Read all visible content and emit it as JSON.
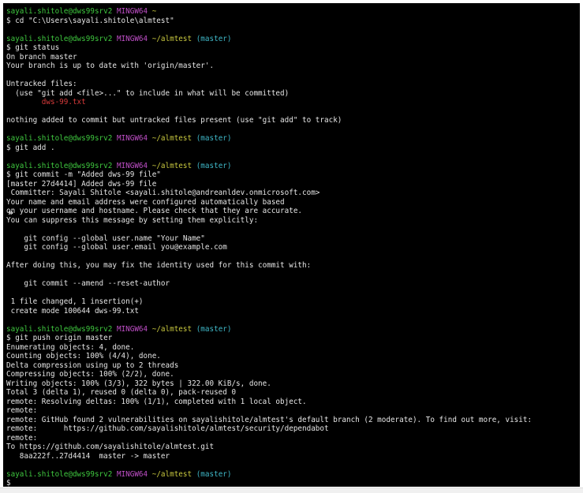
{
  "colors": {
    "terminal_bg": "#000000",
    "text": "#e6e6e6",
    "prompt_user": "#3fc83f",
    "prompt_env": "#c04fc8",
    "prompt_path": "#c8c83f",
    "prompt_branch": "#3fb8c8",
    "untracked_file": "#d63a3a"
  },
  "icons": {
    "collapse": "double-chevron-right-icon"
  },
  "terminal": {
    "lines": [
      [
        {
          "t": "sayali.shitole@dws99srv2 ",
          "c": "user"
        },
        {
          "t": "MINGW64 ",
          "c": "env"
        },
        {
          "t": "~",
          "c": "path"
        }
      ],
      [
        {
          "t": "$ cd \"C:\\Users\\sayali.shitole\\almtest\"",
          "c": "plain"
        }
      ],
      [],
      [
        {
          "t": "sayali.shitole@dws99srv2 ",
          "c": "user"
        },
        {
          "t": "MINGW64 ",
          "c": "env"
        },
        {
          "t": "~/almtest ",
          "c": "path"
        },
        {
          "t": "(master)",
          "c": "branch"
        }
      ],
      [
        {
          "t": "$ git status",
          "c": "plain"
        }
      ],
      [
        {
          "t": "On branch master",
          "c": "plain"
        }
      ],
      [
        {
          "t": "Your branch is up to date with 'origin/master'.",
          "c": "plain"
        }
      ],
      [],
      [
        {
          "t": "Untracked files:",
          "c": "plain"
        }
      ],
      [
        {
          "t": "  (use \"git add <file>...\" to include in what will be committed)",
          "c": "plain"
        }
      ],
      [
        {
          "t": "        dws-99.txt",
          "c": "red"
        }
      ],
      [],
      [
        {
          "t": "nothing added to commit but untracked files present (use \"git add\" to track)",
          "c": "plain"
        }
      ],
      [],
      [
        {
          "t": "sayali.shitole@dws99srv2 ",
          "c": "user"
        },
        {
          "t": "MINGW64 ",
          "c": "env"
        },
        {
          "t": "~/almtest ",
          "c": "path"
        },
        {
          "t": "(master)",
          "c": "branch"
        }
      ],
      [
        {
          "t": "$ git add .",
          "c": "plain"
        }
      ],
      [],
      [
        {
          "t": "sayali.shitole@dws99srv2 ",
          "c": "user"
        },
        {
          "t": "MINGW64 ",
          "c": "env"
        },
        {
          "t": "~/almtest ",
          "c": "path"
        },
        {
          "t": "(master)",
          "c": "branch"
        }
      ],
      [
        {
          "t": "$ git commit -m \"Added dws-99 file\"",
          "c": "plain"
        }
      ],
      [
        {
          "t": "[master 27d4414] Added dws-99 file",
          "c": "plain"
        }
      ],
      [
        {
          "t": " Committer: Sayali Shitole <sayali.shitole@andreanldev.onmicrosoft.com>",
          "c": "plain"
        }
      ],
      [
        {
          "t": "Your name and email address were configured automatically based",
          "c": "plain"
        }
      ],
      [
        {
          "t": "on your username and hostname. Please check that they are accurate.",
          "c": "plain"
        }
      ],
      [
        {
          "t": "You can suppress this message by setting them explicitly:",
          "c": "plain"
        }
      ],
      [],
      [
        {
          "t": "    git config --global user.name \"Your Name\"",
          "c": "plain"
        }
      ],
      [
        {
          "t": "    git config --global user.email you@example.com",
          "c": "plain"
        }
      ],
      [],
      [
        {
          "t": "After doing this, you may fix the identity used for this commit with:",
          "c": "plain"
        }
      ],
      [],
      [
        {
          "t": "    git commit --amend --reset-author",
          "c": "plain"
        }
      ],
      [],
      [
        {
          "t": " 1 file changed, 1 insertion(+)",
          "c": "plain"
        }
      ],
      [
        {
          "t": " create mode 100644 dws-99.txt",
          "c": "plain"
        }
      ],
      [],
      [
        {
          "t": "sayali.shitole@dws99srv2 ",
          "c": "user"
        },
        {
          "t": "MINGW64 ",
          "c": "env"
        },
        {
          "t": "~/almtest ",
          "c": "path"
        },
        {
          "t": "(master)",
          "c": "branch"
        }
      ],
      [
        {
          "t": "$ git push origin master",
          "c": "plain"
        }
      ],
      [
        {
          "t": "Enumerating objects: 4, done.",
          "c": "plain"
        }
      ],
      [
        {
          "t": "Counting objects: 100% (4/4), done.",
          "c": "plain"
        }
      ],
      [
        {
          "t": "Delta compression using up to 2 threads",
          "c": "plain"
        }
      ],
      [
        {
          "t": "Compressing objects: 100% (2/2), done.",
          "c": "plain"
        }
      ],
      [
        {
          "t": "Writing objects: 100% (3/3), 322 bytes | 322.00 KiB/s, done.",
          "c": "plain"
        }
      ],
      [
        {
          "t": "Total 3 (delta 1), reused 0 (delta 0), pack-reused 0",
          "c": "plain"
        }
      ],
      [
        {
          "t": "remote: Resolving deltas: 100% (1/1), completed with 1 local object.",
          "c": "plain"
        }
      ],
      [
        {
          "t": "remote:",
          "c": "plain"
        }
      ],
      [
        {
          "t": "remote: GitHub found 2 vulnerabilities on sayalishitole/almtest's default branch (2 moderate). To find out more, visit:",
          "c": "plain"
        }
      ],
      [
        {
          "t": "remote:      https://github.com/sayalishitole/almtest/security/dependabot",
          "c": "plain"
        }
      ],
      [
        {
          "t": "remote:",
          "c": "plain"
        }
      ],
      [
        {
          "t": "To https://github.com/sayalishitole/almtest.git",
          "c": "plain"
        }
      ],
      [
        {
          "t": "   8aa222f..27d4414  master -> master",
          "c": "plain"
        }
      ],
      [],
      [
        {
          "t": "sayali.shitole@dws99srv2 ",
          "c": "user"
        },
        {
          "t": "MINGW64 ",
          "c": "env"
        },
        {
          "t": "~/almtest ",
          "c": "path"
        },
        {
          "t": "(master)",
          "c": "branch"
        }
      ],
      [
        {
          "t": "$",
          "c": "plain"
        }
      ]
    ]
  }
}
